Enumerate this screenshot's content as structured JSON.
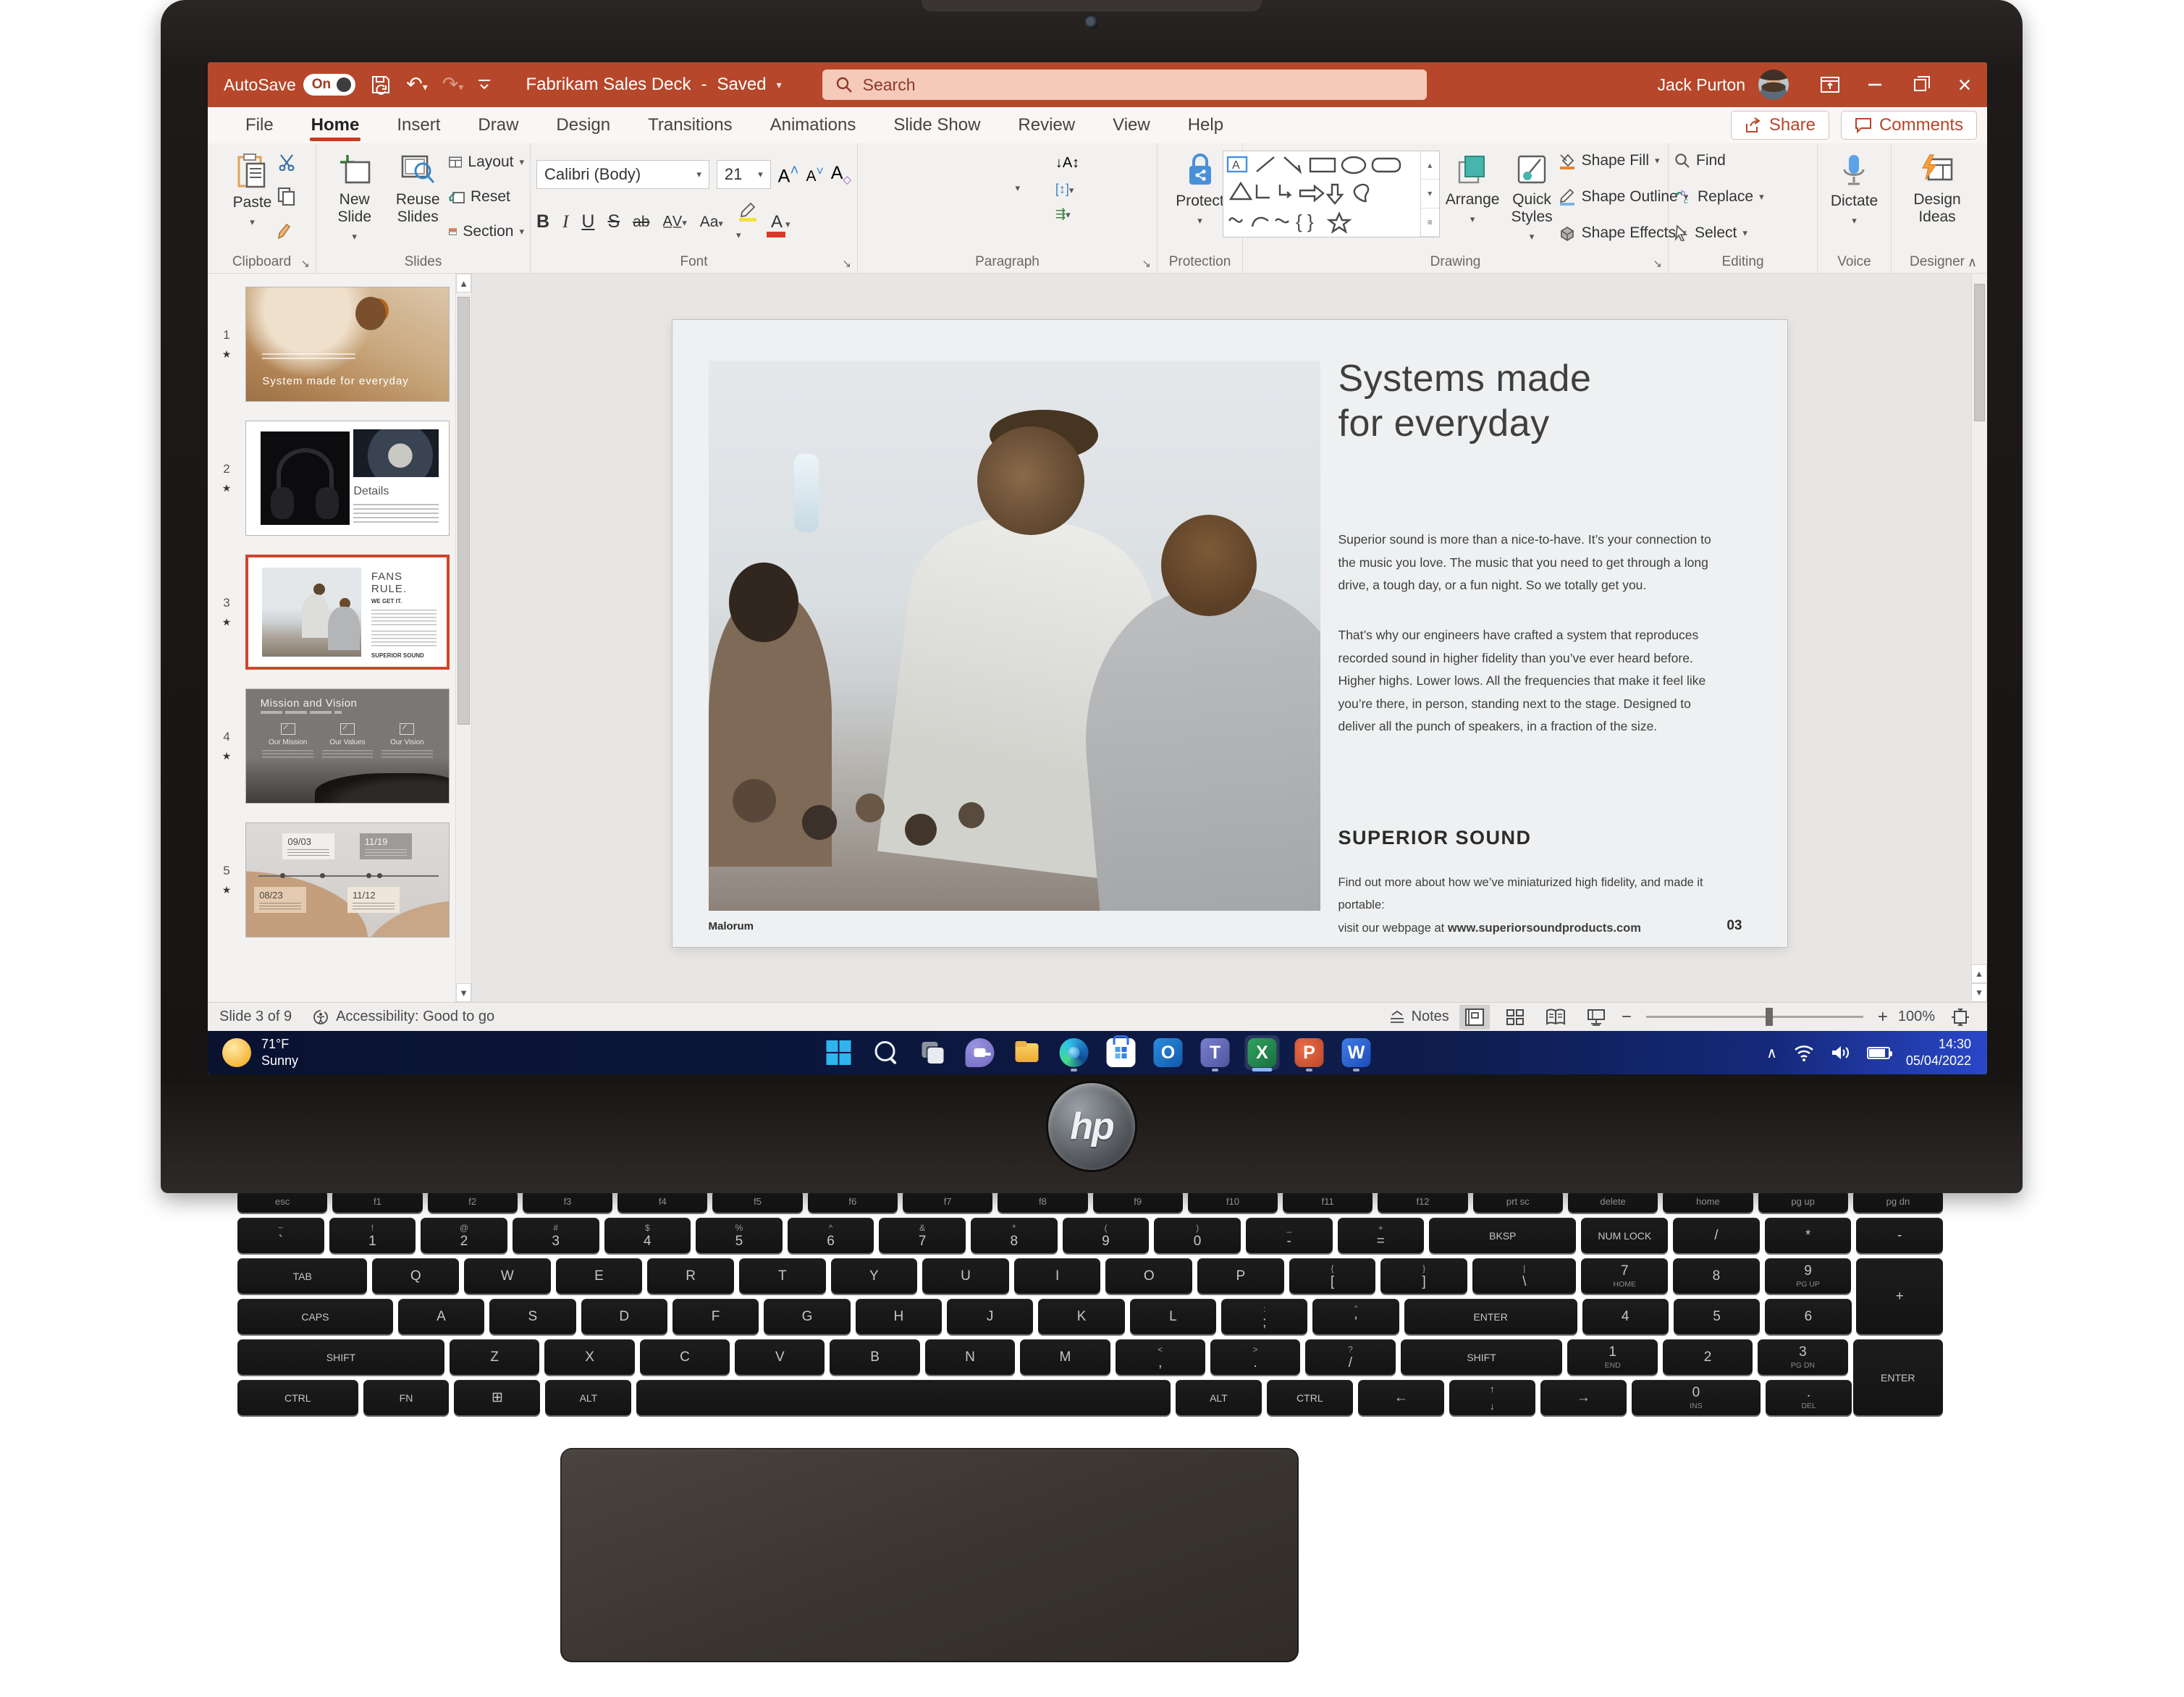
{
  "window": {
    "autosave_label": "AutoSave",
    "autosave_state": "On",
    "doc_title": "Fabrikam Sales Deck",
    "separator": "-",
    "saved_status": "Saved",
    "search_placeholder": "Search",
    "user_name": "Jack Purton"
  },
  "ribbon": {
    "tabs": [
      "File",
      "Home",
      "Insert",
      "Draw",
      "Design",
      "Transitions",
      "Animations",
      "Slide Show",
      "Review",
      "View",
      "Help"
    ],
    "active_tab": "Home",
    "share_label": "Share",
    "comments_label": "Comments",
    "clipboard": {
      "paste": "Paste",
      "label": "Clipboard"
    },
    "slides": {
      "new_slide": "New Slide",
      "reuse_slides": "Reuse Slides",
      "layout": "Layout",
      "reset": "Reset",
      "section": "Section",
      "label": "Slides"
    },
    "font": {
      "family": "Calibri (Body)",
      "size": "21",
      "label": "Font"
    },
    "paragraph": {
      "label": "Paragraph"
    },
    "protection": {
      "protect": "Protect",
      "label": "Protection"
    },
    "drawing": {
      "arrange": "Arrange",
      "quick_styles": "Quick Styles",
      "shape_fill": "Shape Fill",
      "shape_outline": "Shape Outline",
      "shape_effects": "Shape Effects",
      "label": "Drawing"
    },
    "editing": {
      "find": "Find",
      "replace": "Replace",
      "select": "Select",
      "label": "Editing"
    },
    "voice": {
      "dictate": "Dictate",
      "label": "Voice"
    },
    "designer": {
      "design_ideas": "Design Ideas",
      "label": "Designer"
    }
  },
  "thumbnails": [
    {
      "num": "1",
      "star": "★",
      "caption": "System made for everyday"
    },
    {
      "num": "2",
      "star": "★",
      "caption": "Details"
    },
    {
      "num": "3",
      "star": "★",
      "heading": "FANS RULE.",
      "subheading": "WE GET IT.",
      "footer": "SUPERIOR SOUND"
    },
    {
      "num": "4",
      "star": "★",
      "title": "Mission and Vision",
      "cols": [
        "Our Mission",
        "Our Values",
        "Our Vision"
      ]
    },
    {
      "num": "5",
      "star": "★",
      "dates": [
        "09/03",
        "11/19",
        "08/23",
        "11/12"
      ]
    }
  ],
  "slide": {
    "title_line1": "Systems made",
    "title_line2": "for everyday",
    "para1": "Superior sound is more than a nice-to-have. It’s your connection to the music you love. The music that you need to get through a long drive, a tough day, or a fun night. So we totally get you.",
    "para2": "That’s why our engineers have crafted a system that reproduces recorded sound in higher fidelity than you’ve ever heard before. Higher highs. Lower lows. All the frequencies that make it feel like you’re there, in person, standing next to the stage. Designed to deliver all the punch of speakers, in a fraction of the size.",
    "heading": "SUPERIOR SOUND",
    "cta_line1": "Find out more about how we’ve miniaturized high fidelity, and made it portable:",
    "cta_prefix": "visit our webpage at ",
    "cta_url": "www.superiorsoundproducts.com",
    "footer_brand": "Malorum",
    "page_number": "03"
  },
  "statusbar": {
    "slide_info": "Slide 3 of 9",
    "accessibility": "Accessibility: Good to go",
    "notes": "Notes",
    "zoom": "100%"
  },
  "taskbar": {
    "weather_temp": "71°F",
    "weather_condition": "Sunny",
    "icons": [
      {
        "name": "start"
      },
      {
        "name": "search"
      },
      {
        "name": "task-view"
      },
      {
        "name": "chat"
      },
      {
        "name": "file-explorer"
      },
      {
        "name": "edge",
        "running": true
      },
      {
        "name": "store"
      },
      {
        "name": "outlook",
        "letter": "O"
      },
      {
        "name": "teams",
        "letter": "T",
        "running": true
      },
      {
        "name": "excel",
        "letter": "X",
        "active": true
      },
      {
        "name": "powerpoint",
        "letter": "P",
        "running": true
      },
      {
        "name": "word",
        "letter": "W",
        "running": true
      }
    ],
    "time": "14:30",
    "date": "05/04/2022"
  },
  "laptop": {
    "brand": "hp"
  },
  "keyboard": {
    "rows": [
      [
        {
          "k": "esc"
        },
        {
          "k": "f1"
        },
        {
          "k": "f2"
        },
        {
          "k": "f3"
        },
        {
          "k": "f4"
        },
        {
          "k": "f5"
        },
        {
          "k": "f6"
        },
        {
          "k": "f7"
        },
        {
          "k": "f8"
        },
        {
          "k": "f9"
        },
        {
          "k": "f10"
        },
        {
          "k": "f11"
        },
        {
          "k": "f12"
        },
        {
          "k": "prt sc"
        },
        {
          "k": "delete"
        },
        {
          "k": "home"
        },
        {
          "k": "pg up"
        },
        {
          "k": "pg dn"
        }
      ],
      [
        {
          "k": "`",
          "sup": "~"
        },
        {
          "k": "1",
          "sup": "!"
        },
        {
          "k": "2",
          "sup": "@"
        },
        {
          "k": "3",
          "sup": "#"
        },
        {
          "k": "4",
          "sup": "$"
        },
        {
          "k": "5",
          "sup": "%"
        },
        {
          "k": "6",
          "sup": "^"
        },
        {
          "k": "7",
          "sup": "&"
        },
        {
          "k": "8",
          "sup": "*"
        },
        {
          "k": "9",
          "sup": "("
        },
        {
          "k": "0",
          "sup": ")"
        },
        {
          "k": "-",
          "sup": "_"
        },
        {
          "k": "=",
          "sup": "+"
        },
        {
          "k": "bksp",
          "w": 1.7,
          "word": 1
        },
        {
          "k": "num lock",
          "word": 1
        },
        {
          "k": "/"
        },
        {
          "k": "*"
        },
        {
          "k": "-"
        }
      ],
      [
        {
          "k": "tab",
          "w": 1.5,
          "word": 1
        },
        {
          "k": "Q"
        },
        {
          "k": "W"
        },
        {
          "k": "E"
        },
        {
          "k": "R"
        },
        {
          "k": "T"
        },
        {
          "k": "Y"
        },
        {
          "k": "U"
        },
        {
          "k": "I"
        },
        {
          "k": "O"
        },
        {
          "k": "P"
        },
        {
          "k": "[",
          "sup": "{"
        },
        {
          "k": "]",
          "sup": "}"
        },
        {
          "k": "\\",
          "sup": "|",
          "w": 1.2
        },
        {
          "k": "7",
          "sub": "home"
        },
        {
          "k": "8"
        },
        {
          "k": "9",
          "sub": "pg up"
        },
        {
          "k": "+",
          "tall": 1
        }
      ],
      [
        {
          "k": "caps",
          "w": 1.8,
          "word": 1
        },
        {
          "k": "A"
        },
        {
          "k": "S"
        },
        {
          "k": "D"
        },
        {
          "k": "F"
        },
        {
          "k": "G"
        },
        {
          "k": "H"
        },
        {
          "k": "J"
        },
        {
          "k": "K"
        },
        {
          "k": "L"
        },
        {
          "k": ";",
          "sup": ":"
        },
        {
          "k": "'",
          "sup": "\""
        },
        {
          "k": "enter",
          "w": 2,
          "word": 1
        },
        {
          "k": "4"
        },
        {
          "k": "5"
        },
        {
          "k": "6"
        },
        {
          "sp": 1
        }
      ],
      [
        {
          "k": "shift",
          "w": 2.3,
          "word": 1
        },
        {
          "k": "Z"
        },
        {
          "k": "X"
        },
        {
          "k": "C"
        },
        {
          "k": "V"
        },
        {
          "k": "B"
        },
        {
          "k": "N"
        },
        {
          "k": "M"
        },
        {
          "k": ",",
          "sup": "<"
        },
        {
          "k": ".",
          "sup": ">"
        },
        {
          "k": "/",
          "sup": "?"
        },
        {
          "k": "shift",
          "w": 1.8,
          "word": 1
        },
        {
          "k": "1",
          "sub": "end"
        },
        {
          "k": "2"
        },
        {
          "k": "3",
          "sub": "pg dn"
        },
        {
          "k": "enter",
          "tall": 1,
          "word": 1
        }
      ],
      [
        {
          "k": "ctrl",
          "w": 1.4,
          "word": 1
        },
        {
          "k": "fn",
          "word": 1
        },
        {
          "k": "⊞",
          "id": "win"
        },
        {
          "k": "alt",
          "word": 1
        },
        {
          "k": "",
          "id": "space",
          "w": 6.2
        },
        {
          "k": "alt",
          "word": 1
        },
        {
          "k": "ctrl",
          "word": 1
        },
        {
          "k": "←"
        },
        {
          "k": "↑↓",
          "split": 1,
          "id": "up-down"
        },
        {
          "k": "→"
        },
        {
          "k": "0",
          "sub": "ins",
          "w": 1.5
        },
        {
          "k": ".",
          "sub": "del"
        },
        {
          "sp": 1
        }
      ]
    ]
  }
}
